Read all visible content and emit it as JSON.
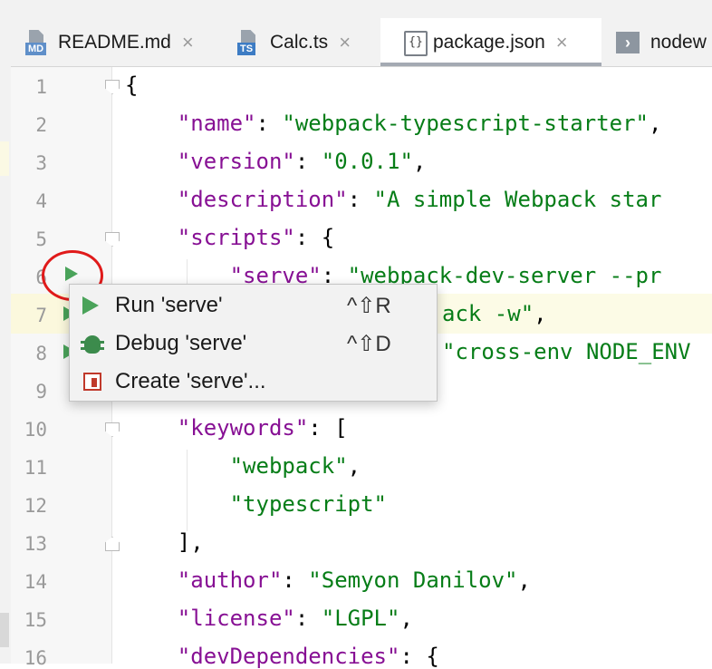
{
  "tabs": [
    {
      "label": "README.md",
      "badge": "MD",
      "icon": "markdown-file-icon",
      "close": "×"
    },
    {
      "label": "Calc.ts",
      "badge": "TS",
      "icon": "typescript-file-icon",
      "close": "×"
    },
    {
      "label": "package.json",
      "icon": "json-file-icon",
      "icon_glyph": "{}",
      "close": "×",
      "active": true
    },
    {
      "label": "nodew",
      "icon": "terminal-icon",
      "icon_glyph": "›"
    }
  ],
  "line_numbers": [
    "1",
    "2",
    "3",
    "4",
    "5",
    "6",
    "7",
    "8",
    "9",
    "10",
    "11",
    "12",
    "13",
    "14",
    "15",
    "16"
  ],
  "code": {
    "l1": "{",
    "l2_key": "\"name\"",
    "l2_sep": ": ",
    "l2_val": "\"webpack-typescript-starter\"",
    "l2_end": ",",
    "l3_key": "\"version\"",
    "l3_sep": ": ",
    "l3_val": "\"0.0.1\"",
    "l3_end": ",",
    "l4_key": "\"description\"",
    "l4_sep": ": ",
    "l4_val": "\"A simple Webpack star",
    "l5_key": "\"scripts\"",
    "l5_sep": ": {",
    "l6_key": "\"serve\"",
    "l6_sep": ": ",
    "l6_val": "\"webpack-dev-server --pr",
    "l7_val": "ack -w\"",
    "l7_end": ",",
    "l8_val": "\"cross-env NODE_ENV",
    "l9": "},",
    "l10_key": "\"keywords\"",
    "l10_sep": ": [",
    "l11_val": "\"webpack\"",
    "l11_end": ",",
    "l12_val": "\"typescript\"",
    "l13": "],",
    "l14_key": "\"author\"",
    "l14_sep": ": ",
    "l14_val": "\"Semyon Danilov\"",
    "l14_end": ",",
    "l15_key": "\"license\"",
    "l15_sep": ": ",
    "l15_val": "\"LGPL\"",
    "l15_end": ",",
    "l16_key": "\"devDependencies\"",
    "l16_sep": ": {"
  },
  "popup": {
    "items": [
      {
        "label": "Run 'serve'",
        "shortcut": "^⇧R",
        "icon": "run-icon"
      },
      {
        "label": "Debug 'serve'",
        "shortcut": "^⇧D",
        "icon": "debug-icon"
      },
      {
        "label": "Create 'serve'...",
        "shortcut": "",
        "icon": "run-config-icon"
      }
    ]
  },
  "colors": {
    "json_key": "#871094",
    "json_string": "#067d17",
    "run_green": "#4aa35a",
    "annotation_red": "#e01a1a"
  }
}
